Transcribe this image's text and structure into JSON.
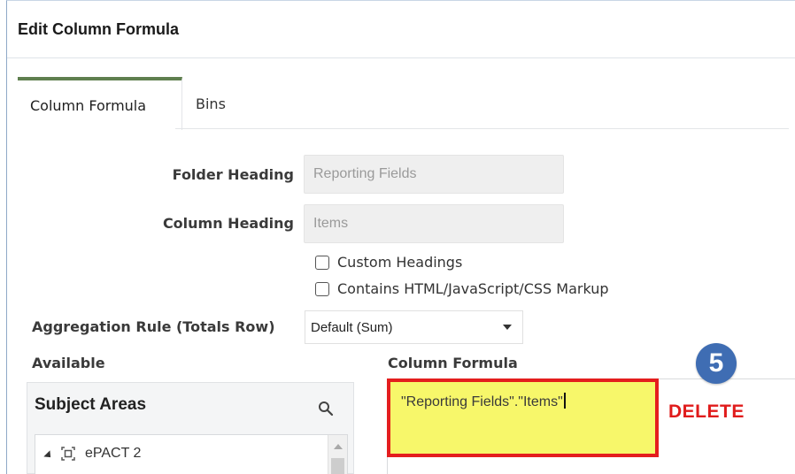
{
  "dialog": {
    "title": "Edit Column Formula"
  },
  "tabs": [
    {
      "label": "Column Formula",
      "active": true
    },
    {
      "label": "Bins",
      "active": false
    }
  ],
  "form": {
    "folder_heading_label": "Folder Heading",
    "folder_heading_value": "Reporting Fields",
    "column_heading_label": "Column Heading",
    "column_heading_value": "Items",
    "custom_headings_label": "Custom Headings",
    "custom_headings_checked": false,
    "contains_markup_label": "Contains HTML/JavaScript/CSS Markup",
    "contains_markup_checked": false,
    "aggregation_label": "Aggregation Rule (Totals Row)",
    "aggregation_value": "Default (Sum)"
  },
  "available": {
    "label": "Available",
    "panel_title": "Subject Areas",
    "tree_items": [
      {
        "label": "ePACT 2",
        "expanded": true
      }
    ]
  },
  "column_formula": {
    "label": "Column Formula",
    "text": "\"Reporting Fields\".\"Items\""
  },
  "annotation": {
    "step_number": "5",
    "action_label": "DELETE",
    "badge_color": "#3f6db3",
    "highlight_border_color": "#e41e1e",
    "highlight_fill_color": "#f7f76a"
  },
  "icons": {
    "search": "search-icon",
    "subject_area": "subject-area-icon",
    "expand": "expand-triangle-icon",
    "dropdown": "chevron-down-icon"
  }
}
